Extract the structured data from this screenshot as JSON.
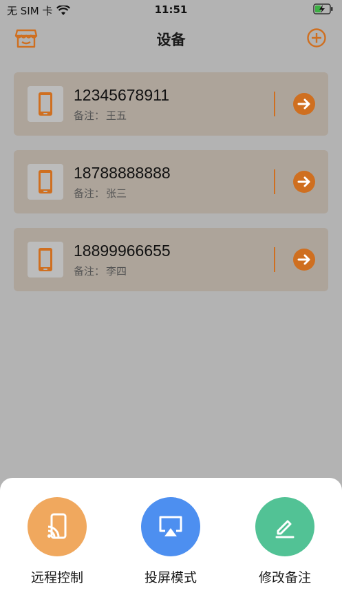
{
  "status_bar": {
    "carrier": "无 SIM 卡",
    "time": "11:51"
  },
  "nav": {
    "title": "设备"
  },
  "devices": [
    {
      "phone": "12345678911",
      "note_label": "备注：",
      "note": "王五"
    },
    {
      "phone": "18788888888",
      "note_label": "备注：",
      "note": "张三"
    },
    {
      "phone": "18899966655",
      "note_label": "备注：",
      "note": "李四"
    }
  ],
  "actions": [
    {
      "label": "远程控制",
      "icon": "cast-phone-icon",
      "color": "#f0a85e"
    },
    {
      "label": "投屏模式",
      "icon": "airplay-icon",
      "color": "#4d8ff0"
    },
    {
      "label": "修改备注",
      "icon": "edit-icon",
      "color": "#52c295"
    }
  ],
  "colors": {
    "accent": "#cf6f20",
    "card": "#ada49a",
    "overlay": "#b3b3b3"
  }
}
